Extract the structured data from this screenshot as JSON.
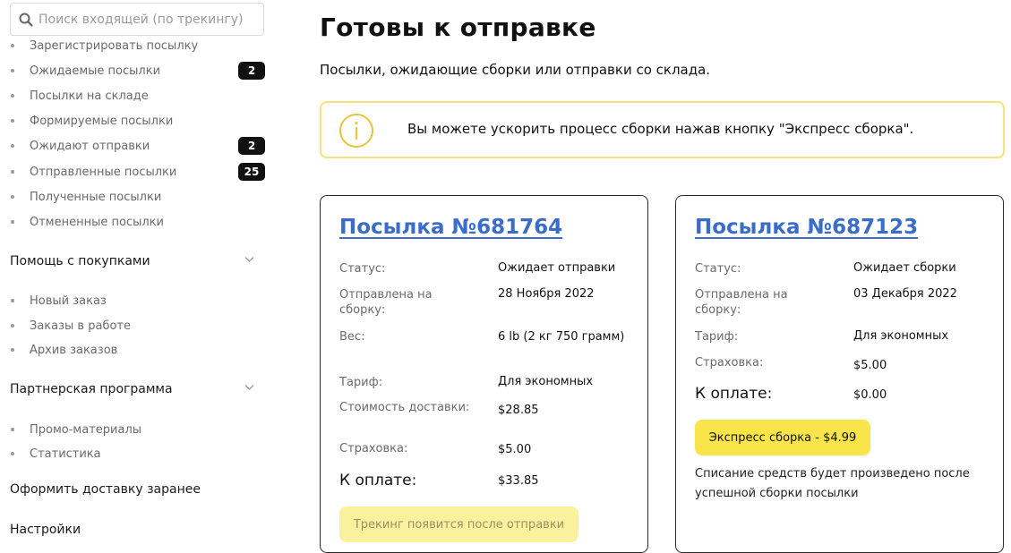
{
  "search": {
    "placeholder": "Поиск входящей (по трекингу)"
  },
  "sidebar": {
    "parcels": [
      {
        "label": "Зарегистрировать посылку",
        "badge": ""
      },
      {
        "label": "Ожидаемые посылки",
        "badge": "2"
      },
      {
        "label": "Посылки на складе",
        "badge": ""
      },
      {
        "label": "Формируемые посылки",
        "badge": ""
      },
      {
        "label": "Ожидают отправки",
        "badge": "2"
      },
      {
        "label": "Отправленные посылки",
        "badge": "25"
      },
      {
        "label": "Полученные посылки",
        "badge": ""
      },
      {
        "label": "Отмененные посылки",
        "badge": ""
      }
    ],
    "help": {
      "title": "Помощь с покупками",
      "items": [
        "Новый заказ",
        "Заказы в работе",
        "Архив заказов"
      ]
    },
    "partner": {
      "title": "Партнерская программа",
      "items": [
        "Промо-материалы",
        "Статистика"
      ]
    },
    "prepay_delivery": "Оформить доставку заранее",
    "settings": "Настройки"
  },
  "main": {
    "title": "Готовы к отправке",
    "subtitle": "Посылки, ожидающие сборки или отправки со склада.",
    "info_text": "Вы можете ускорить процесс сборки нажав кнопку \"Экспресс сборка\"."
  },
  "cards": [
    {
      "title": "Посылка №681764",
      "rows": {
        "status": {
          "k": "Статус:",
          "v": "Ожидает отправки"
        },
        "sent": {
          "k": "Отправлена на сборку:",
          "v": "28 Ноября 2022"
        },
        "weight": {
          "k": "Вес:",
          "v": "6 lb (2 кг 750 грамм)"
        },
        "tariff": {
          "k": "Тариф:",
          "v": "Для экономных"
        },
        "cost": {
          "k": "Стоимость доставки:",
          "v": "$28.85"
        },
        "insurance": {
          "k": "Страховка:",
          "v": "$5.00"
        },
        "total": {
          "k": "К оплате:",
          "v": "$33.85"
        }
      },
      "tracking_button": "Трекинг появится после отправки"
    },
    {
      "title": "Посылка №687123",
      "rows": {
        "status": {
          "k": "Статус:",
          "v": "Ожидает сборки"
        },
        "sent": {
          "k": "Отправлена на сборку:",
          "v": "03 Декабря 2022"
        },
        "tariff": {
          "k": "Тариф:",
          "v": "Для экономных"
        },
        "insurance": {
          "k": "Страховка:",
          "v": "$5.00"
        },
        "total": {
          "k": "К оплате:",
          "v": "$0.00"
        }
      },
      "express_button": "Экспресс сборка - $4.99",
      "note": "Списание средств будет произведено после успешной сборки посылки"
    }
  ]
}
